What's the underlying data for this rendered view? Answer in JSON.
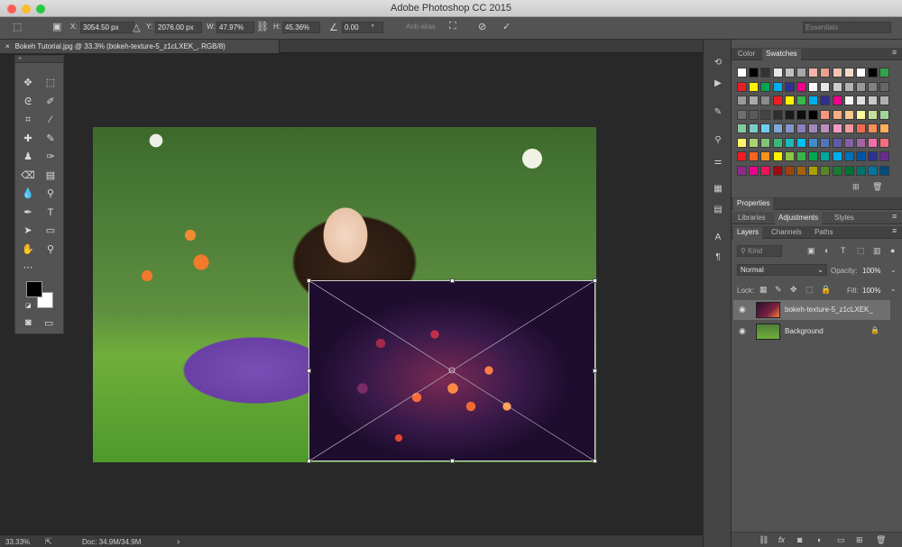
{
  "window": {
    "title": "Adobe Photoshop CC 2015"
  },
  "options_bar": {
    "x_label": "X:",
    "x_value": "3054.50 px",
    "y_label": "Y:",
    "y_value": "2076.00 px",
    "w_label": "W:",
    "w_value": "47.97%",
    "h_label": "H:",
    "h_value": "45.36%",
    "angle_value": "0.00",
    "angle_unit": "°",
    "anti_alias": "Anti-alias",
    "workspace": "Essentials"
  },
  "document_tab": {
    "title": "Bokeh Tutorial.jpg @ 33.3% (bokeh-texture-5_z1cLXEK_, RGB/8)",
    "close": "×"
  },
  "status_bar": {
    "zoom": "33.33%",
    "doc": "Doc: 34.9M/34.9M",
    "arrow": "›"
  },
  "tools": {
    "header": "× ",
    "icons": [
      "move-icon",
      "marquee-icon",
      "lasso-icon",
      "quick-select-icon",
      "crop-icon",
      "eyedropper-icon",
      "healing-icon",
      "brush-icon",
      "stamp-icon",
      "history-brush-icon",
      "eraser-icon",
      "gradient-icon",
      "blur-icon",
      "dodge-icon",
      "pen-icon",
      "type-icon",
      "path-select-icon",
      "shape-icon",
      "hand-icon",
      "zoom-icon",
      "more-icon"
    ],
    "foreground": "#000000",
    "background": "#ffffff"
  },
  "swatches_panel": {
    "tabs": [
      "Color",
      "Swatches"
    ],
    "active_tab": "Swatches",
    "colors": [
      [
        "#ffffff",
        "#000000",
        "#333333",
        "#e8e8e8",
        "#c0c0c0",
        "#a8a8a8",
        "#f2b6a8",
        "#e8a090",
        "#f4c4b0",
        "#f6d8c6",
        "#ffffff",
        "#000000",
        "#2fa24a"
      ],
      [
        "#ed1c24",
        "#fff200",
        "#00a651",
        "#00aeef",
        "#2e3192",
        "#ec008c",
        "#ffffff",
        "#e6e6e6",
        "#cccccc",
        "#b3b3b3",
        "#999999",
        "#808080",
        "#666666"
      ],
      [
        "#999999",
        "#aaaaaa",
        "#8c8c8c",
        "#ed1c24",
        "#fff200",
        "#39b54a",
        "#00aeef",
        "#2e3192",
        "#ec008c",
        "#f5f5f5",
        "#e0e0e0",
        "#c8c8c8",
        "#b0b0b0"
      ],
      [
        "#707070",
        "#5a5a5a",
        "#444444",
        "#2e2e2e",
        "#1a1a1a",
        "#0d0d0d",
        "#000000",
        "#f7977a",
        "#f9ad81",
        "#fdc68a",
        "#fff79a",
        "#c4df9b",
        "#a3d39c"
      ],
      [
        "#82ca9d",
        "#7bcdc8",
        "#6ecff6",
        "#7ea7d8",
        "#8493ca",
        "#8882be",
        "#a187be",
        "#bc8dbf",
        "#f49ac2",
        "#f6989d",
        "#f26c4f",
        "#f68e55",
        "#fbaf5c"
      ],
      [
        "#fff467",
        "#acd372",
        "#7cc576",
        "#3bb878",
        "#1abbb4",
        "#00bff3",
        "#438ccb",
        "#5574b9",
        "#605ca8",
        "#855fa8",
        "#a763a8",
        "#f06ea9",
        "#f26d7d"
      ],
      [
        "#ed1c24",
        "#f26522",
        "#f7941d",
        "#fff200",
        "#8dc63f",
        "#39b54a",
        "#00a651",
        "#00a99d",
        "#00aeef",
        "#0072bc",
        "#0054a6",
        "#2e3192",
        "#662d91"
      ],
      [
        "#92278f",
        "#ec008c",
        "#ed145b",
        "#9e0b0f",
        "#a0410d",
        "#a36209",
        "#aba000",
        "#598527",
        "#197b30",
        "#007236",
        "#00746b",
        "#0076a3",
        "#004b80"
      ]
    ]
  },
  "properties_panel": {
    "title": "Properties",
    "tabs": [
      "Libraries",
      "Adjustments",
      "Styles"
    ],
    "active_tab": "Adjustments"
  },
  "layers_panel": {
    "tabs": [
      "Layers",
      "Channels",
      "Paths"
    ],
    "active_tab": "Layers",
    "kind_label": "Kind",
    "blend_mode": "Normal",
    "opacity_label": "Opacity:",
    "opacity_value": "100%",
    "lock_label": "Lock:",
    "fill_label": "Fill:",
    "fill_value": "100%",
    "layers": [
      {
        "name": "bokeh-texture-5_z1cLXEK_",
        "selected": true
      },
      {
        "name": "Background",
        "selected": false,
        "locked": true
      }
    ],
    "footer_icons": [
      "link-icon",
      "fx-icon",
      "mask-icon",
      "adjustment-icon",
      "folder-icon",
      "new-layer-icon",
      "trash-icon"
    ]
  }
}
